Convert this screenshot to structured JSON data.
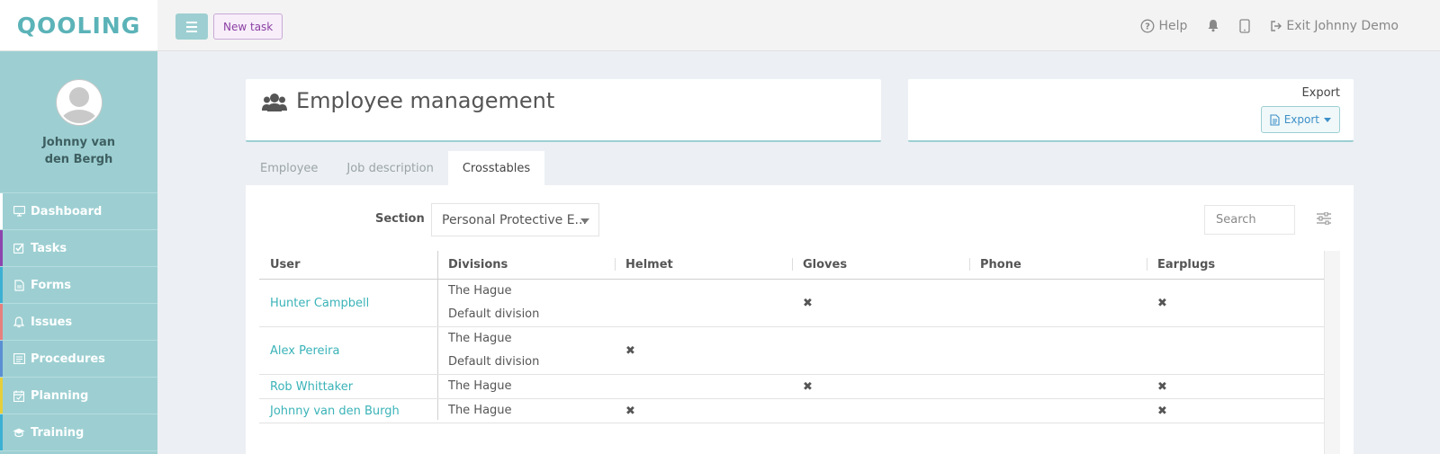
{
  "app": {
    "logo": "QOOLING"
  },
  "profile": {
    "name": "Johnny van den Bergh"
  },
  "sidebar": {
    "items": [
      {
        "label": "Dashboard",
        "icon": "monitor-icon",
        "color": "#ffffff"
      },
      {
        "label": "Tasks",
        "icon": "checkbox-icon",
        "color": "#8e44ad"
      },
      {
        "label": "Forms",
        "icon": "document-icon",
        "color": "#3cb0d3"
      },
      {
        "label": "Issues",
        "icon": "bell-icon",
        "color": "#e87f7f"
      },
      {
        "label": "Procedures",
        "icon": "list-icon",
        "color": "#5b8fd3"
      },
      {
        "label": "Planning",
        "icon": "calendar-icon",
        "color": "#e6cf3a"
      },
      {
        "label": "Training",
        "icon": "graduation-cap-icon",
        "color": "#3cb0d3"
      }
    ]
  },
  "topbar": {
    "new_task": "New task",
    "help": "Help",
    "exit": "Exit Johnny Demo"
  },
  "header": {
    "title": "Employee management",
    "export_label": "Export",
    "export_button": "Export"
  },
  "tabs": [
    {
      "label": "Employee",
      "active": false
    },
    {
      "label": "Job description",
      "active": false
    },
    {
      "label": "Crosstables",
      "active": true
    }
  ],
  "filters": {
    "section_label": "Section",
    "section_value": "Personal Protective E...",
    "search_placeholder": "Search"
  },
  "table": {
    "columns": [
      "User",
      "Divisions",
      "Helmet",
      "Gloves",
      "Phone",
      "Earplugs"
    ],
    "mark_symbol": "✖",
    "rows": [
      {
        "user": "Hunter Campbell",
        "divisions": [
          "The Hague",
          "Default division"
        ],
        "helmet": false,
        "gloves": true,
        "phone": false,
        "earplugs": true
      },
      {
        "user": "Alex Pereira",
        "divisions": [
          "The Hague",
          "Default division"
        ],
        "helmet": true,
        "gloves": false,
        "phone": false,
        "earplugs": false
      },
      {
        "user": "Rob Whittaker",
        "divisions": [
          "The Hague"
        ],
        "helmet": false,
        "gloves": true,
        "phone": false,
        "earplugs": true
      },
      {
        "user": "Johnny van den Burgh",
        "divisions": [
          "The Hague"
        ],
        "helmet": true,
        "gloves": false,
        "phone": false,
        "earplugs": true
      }
    ]
  }
}
